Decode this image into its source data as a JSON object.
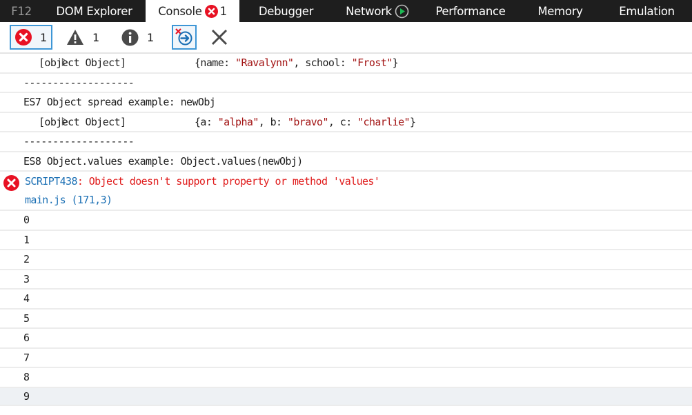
{
  "tabs": [
    {
      "id": "f12",
      "label": "F12"
    },
    {
      "id": "dom",
      "label": "DOM Explorer"
    },
    {
      "id": "console",
      "label": "Console",
      "badge_count": "1",
      "badge_icon": "error-icon",
      "active": true
    },
    {
      "id": "debugger",
      "label": "Debugger"
    },
    {
      "id": "network",
      "label": "Network",
      "badge_icon": "play-icon"
    },
    {
      "id": "performance",
      "label": "Performance"
    },
    {
      "id": "memory",
      "label": "Memory"
    },
    {
      "id": "emulation",
      "label": "Emulation"
    }
  ],
  "toolbar": {
    "errors_count": "1",
    "warnings_count": "1",
    "info_count": "1",
    "clear_on_navigate_icon": "clear-on-navigate-icon",
    "clear_icon": "close-icon"
  },
  "colors": {
    "tabbar_bg": "#1e1e1e",
    "error_red": "#e81123",
    "link_blue": "#1a6fb4",
    "string_red": "#a31515",
    "active_border": "#3d96d6",
    "play_green": "#1db954"
  },
  "log": {
    "row0": {
      "label": "[object Object]",
      "preview": [
        {
          "t": "{name: "
        },
        {
          "t": "\"Ravalynn\"",
          "s": true
        },
        {
          "t": ", school: "
        },
        {
          "t": "\"Frost\"",
          "s": true
        },
        {
          "t": "}"
        }
      ]
    },
    "row1": {
      "text": "-------------------"
    },
    "row2": {
      "text": "ES7 Object spread example: newObj"
    },
    "row3": {
      "label": "[object Object]",
      "preview": [
        {
          "t": "{a: "
        },
        {
          "t": "\"alpha\"",
          "s": true
        },
        {
          "t": ", b: "
        },
        {
          "t": "\"bravo\"",
          "s": true
        },
        {
          "t": ", c: "
        },
        {
          "t": "\"charlie\"",
          "s": true
        },
        {
          "t": "}"
        }
      ]
    },
    "row4": {
      "text": "-------------------"
    },
    "row5": {
      "text": "ES8 Object.values example: Object.values(newObj)"
    },
    "error": {
      "code": "SCRIPT438",
      "message": ": Object doesn't support property or method 'values'",
      "source": "main.js (171,3)"
    },
    "numbers": [
      "0",
      "1",
      "2",
      "3",
      "4",
      "5",
      "6",
      "7",
      "8",
      "9"
    ]
  }
}
